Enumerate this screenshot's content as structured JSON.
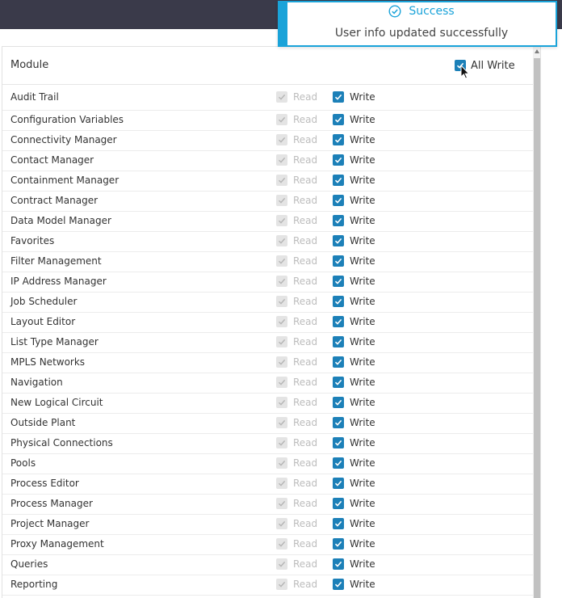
{
  "toast": {
    "title": "Success",
    "message": "User info updated successfully",
    "accent": "#1aa3d9"
  },
  "header": {
    "module_label": "Module",
    "all_write_label": "All Write",
    "all_write_checked": true
  },
  "colors": {
    "checkbox_checked": "#1c80b8",
    "checkbox_disabled": "#e4e4e4",
    "topbar": "#3a3a4a"
  },
  "rows": [
    {
      "name": "Audit Trail",
      "read_label": "Read",
      "write_label": "Write"
    },
    {
      "name": "Configuration Variables",
      "read_label": "Read",
      "write_label": "Write"
    },
    {
      "name": "Connectivity Manager",
      "read_label": "Read",
      "write_label": "Write"
    },
    {
      "name": "Contact Manager",
      "read_label": "Read",
      "write_label": "Write"
    },
    {
      "name": "Containment Manager",
      "read_label": "Read",
      "write_label": "Write"
    },
    {
      "name": "Contract Manager",
      "read_label": "Read",
      "write_label": "Write"
    },
    {
      "name": "Data Model Manager",
      "read_label": "Read",
      "write_label": "Write"
    },
    {
      "name": "Favorites",
      "read_label": "Read",
      "write_label": "Write"
    },
    {
      "name": "Filter Management",
      "read_label": "Read",
      "write_label": "Write"
    },
    {
      "name": "IP Address Manager",
      "read_label": "Read",
      "write_label": "Write"
    },
    {
      "name": "Job Scheduler",
      "read_label": "Read",
      "write_label": "Write"
    },
    {
      "name": "Layout Editor",
      "read_label": "Read",
      "write_label": "Write"
    },
    {
      "name": "List Type Manager",
      "read_label": "Read",
      "write_label": "Write"
    },
    {
      "name": "MPLS Networks",
      "read_label": "Read",
      "write_label": "Write"
    },
    {
      "name": "Navigation",
      "read_label": "Read",
      "write_label": "Write"
    },
    {
      "name": "New Logical Circuit",
      "read_label": "Read",
      "write_label": "Write"
    },
    {
      "name": "Outside Plant",
      "read_label": "Read",
      "write_label": "Write"
    },
    {
      "name": "Physical Connections",
      "read_label": "Read",
      "write_label": "Write"
    },
    {
      "name": "Pools",
      "read_label": "Read",
      "write_label": "Write"
    },
    {
      "name": "Process Editor",
      "read_label": "Read",
      "write_label": "Write"
    },
    {
      "name": "Process Manager",
      "read_label": "Read",
      "write_label": "Write"
    },
    {
      "name": "Project Manager",
      "read_label": "Read",
      "write_label": "Write"
    },
    {
      "name": "Proxy Management",
      "read_label": "Read",
      "write_label": "Write"
    },
    {
      "name": "Queries",
      "read_label": "Read",
      "write_label": "Write"
    },
    {
      "name": "Reporting",
      "read_label": "Read",
      "write_label": "Write"
    }
  ]
}
